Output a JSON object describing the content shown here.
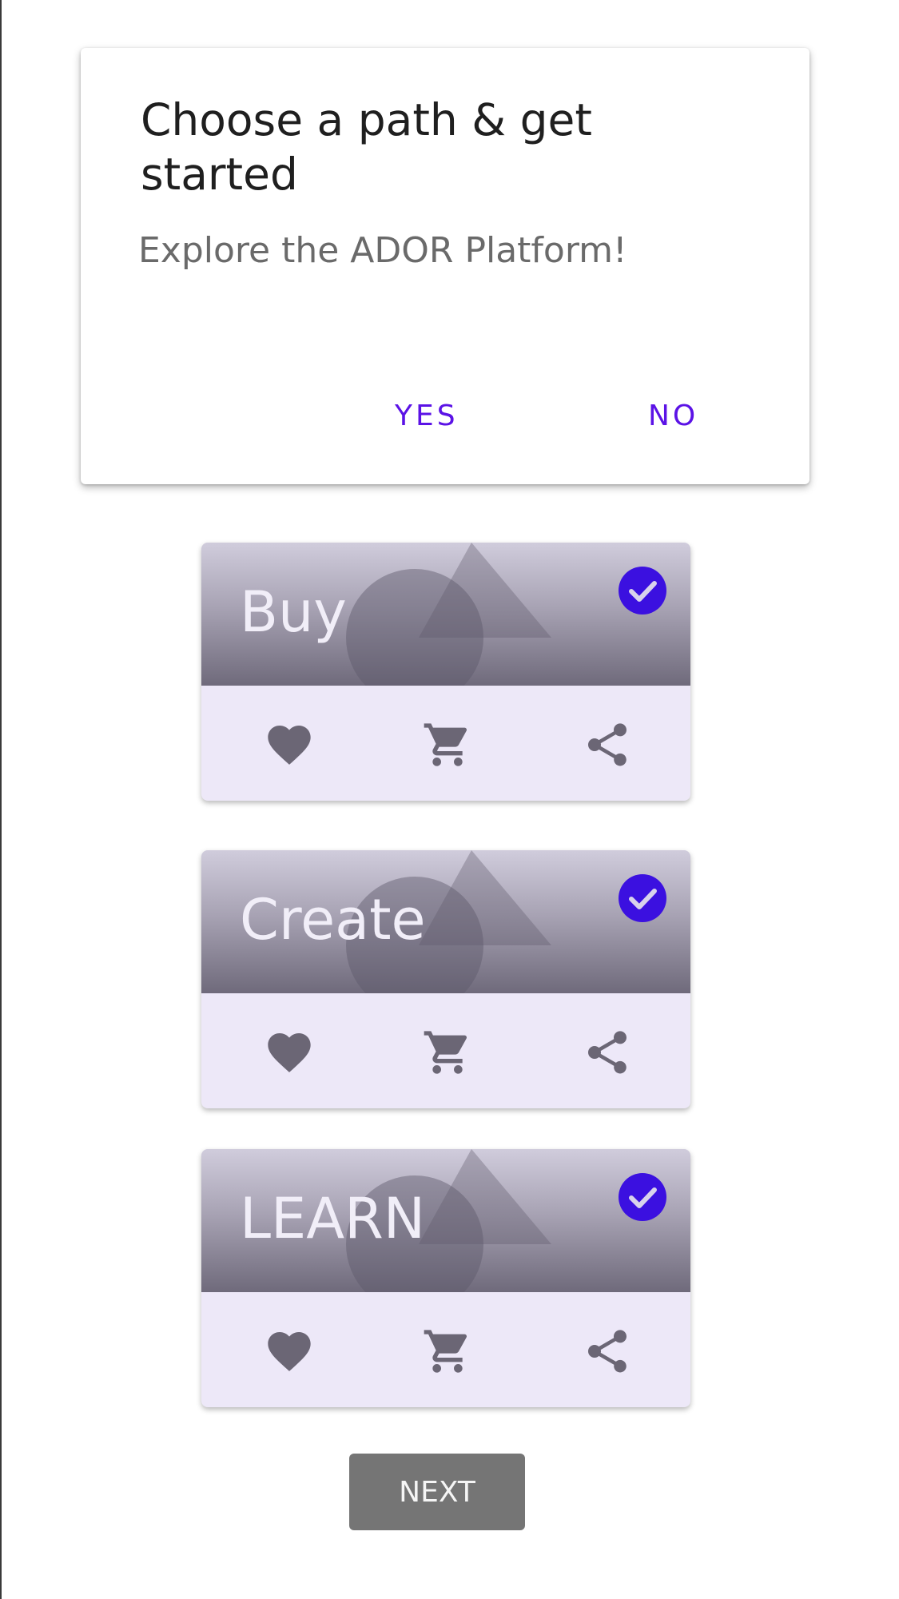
{
  "dialog": {
    "title": "Choose a path & get started",
    "body": "Explore the ADOR Platform!",
    "yes_label": "YES",
    "no_label": "NO"
  },
  "cards": [
    {
      "title": "Buy",
      "selected": true
    },
    {
      "title": "Create",
      "selected": true
    },
    {
      "title": "LEARN",
      "selected": true
    }
  ],
  "card_actions": [
    "heart-icon",
    "cart-icon",
    "share-icon"
  ],
  "next_label": "NEXT",
  "colors": {
    "accent": "#5b12e6",
    "check_badge": "#3b10e0",
    "action_icon": "#6b6675",
    "card_actions_bg": "#ede8f8",
    "next_button_bg": "#757575"
  }
}
